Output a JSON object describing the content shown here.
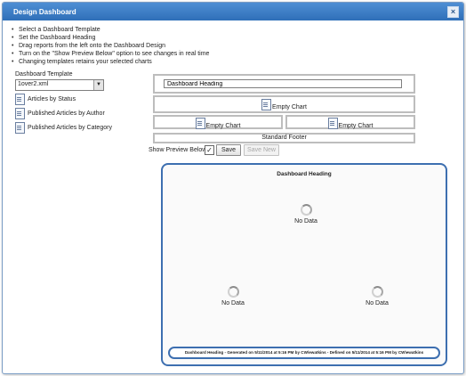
{
  "window": {
    "title": "Design Dashboard",
    "close_glyph": "×"
  },
  "instructions": [
    "Select a Dashboard Template",
    "Set the Dashboard Heading",
    "Drag reports from the left onto the Dashboard Design",
    "Turn on the \"Show Preview Below\" option to see changes in real time",
    "Changing templates retains your selected charts"
  ],
  "template": {
    "label": "Dashboard Template",
    "selected": "1over2.xml"
  },
  "reports": [
    {
      "label": "Articles by Status"
    },
    {
      "label": "Published Articles by Author"
    },
    {
      "label": "Published Articles by Category"
    }
  ],
  "design": {
    "heading_value": "Dashboard Heading",
    "top_chart": "Empty Chart",
    "bottom_left_chart": "Empty Chart",
    "bottom_right_chart": "Empty Chart",
    "footer": "Standard Footer"
  },
  "controls": {
    "show_preview_label": "Show Preview Below:",
    "show_preview_checked": "✓",
    "save_label": "Save",
    "save_new_label": "Save New"
  },
  "preview": {
    "heading": "Dashboard Heading",
    "top_status": "No Data",
    "bottom_left_status": "No Data",
    "bottom_right_status": "No Data",
    "footer": "Dashboard Heading - Generated on 5/11/2014 at 5:16 PM by CW\\ewatkins - Defined on 5/11/2014 at 5:16 PM by CW\\ewatkins"
  }
}
